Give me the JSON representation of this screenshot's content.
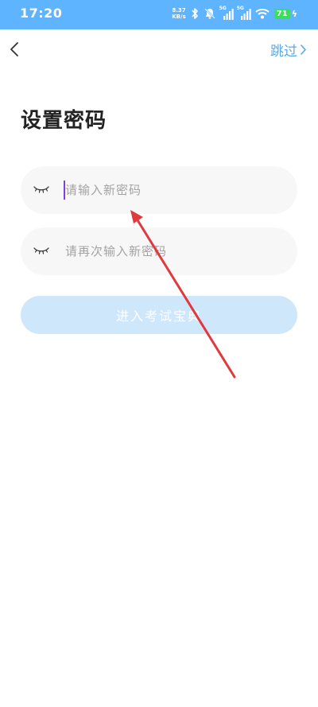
{
  "status_bar": {
    "time": "17:20",
    "net_speed_value": "8.37",
    "net_speed_unit": "KB/s",
    "sim1_tag": "5G",
    "sim2_tag": "5G",
    "battery": "71",
    "icons": [
      "bluetooth-icon",
      "mute-icon",
      "signal-icon",
      "signal-icon",
      "wifi-icon",
      "battery-icon",
      "charging-icon"
    ],
    "bg_color": "#5fb4ff"
  },
  "nav": {
    "skip_label": "跳过"
  },
  "page": {
    "title": "设置密码"
  },
  "form": {
    "new_password_placeholder": "请输入新密码",
    "confirm_password_placeholder": "请再次输入新密码",
    "submit_label": "进入考试宝典"
  },
  "colors": {
    "accent": "#5aa9e6",
    "button_disabled": "#cfe7fb",
    "input_bg": "#f7f7f7",
    "annotation": "#e0393e"
  }
}
